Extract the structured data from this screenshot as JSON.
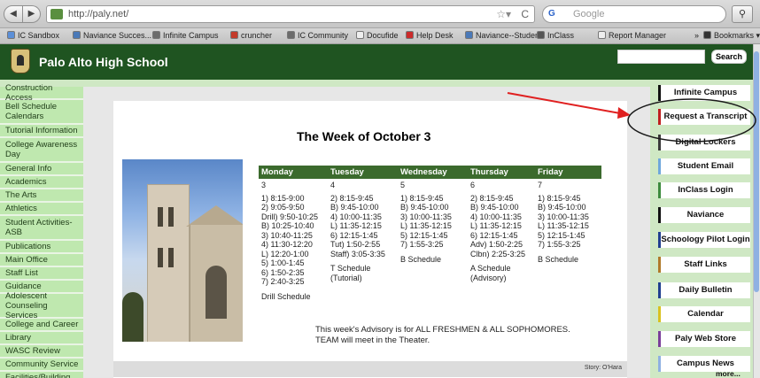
{
  "browser": {
    "url": "http://paly.net/",
    "search_engine_label": "G",
    "search_placeholder": "Google",
    "back_glyph": "◀",
    "forward_glyph": "▶",
    "star_glyph": "☆▾",
    "reload_glyph": "C",
    "magnifier_glyph": "⚲",
    "bookmarks": [
      {
        "label": "IC Sandbox",
        "color": "#5b8fd8"
      },
      {
        "label": "Naviance Succes...",
        "color": "#4a79b8"
      },
      {
        "label": "Infinite Campus",
        "color": "#6b6b6b"
      },
      {
        "label": "cruncher",
        "color": "#c33a2a"
      },
      {
        "label": "IC Community",
        "color": "#6b6b6b"
      },
      {
        "label": "Docufide",
        "color": "#eeeeee"
      },
      {
        "label": "Help Desk",
        "color": "#cc2a2a"
      },
      {
        "label": "Naviance--Student",
        "color": "#4a79b8"
      },
      {
        "label": "InClass",
        "color": "#555555"
      },
      {
        "label": "Report Manager",
        "color": "#eeeeee"
      },
      {
        "label": "»",
        "color": "transparent"
      },
      {
        "label": "Bookmarks ▾",
        "color": "#333333"
      }
    ]
  },
  "header": {
    "title": "Palo Alto High School",
    "search_button": "Search",
    "search_value": ""
  },
  "left_nav": [
    "Construction Access",
    "Bell Schedule Calendars",
    "Tutorial Information",
    "College Awareness Day",
    "General Info",
    "Academics",
    "The Arts",
    "Athletics",
    "Student Activities-ASB",
    "Publications",
    "Main Office",
    "Staff List",
    "Guidance",
    "Adolescent Counseling Services",
    "College and Career",
    "Library",
    "WASC Review",
    "Community Service",
    "Facilities/Building"
  ],
  "main": {
    "week_title": "The Week of October 3",
    "days": [
      {
        "name": "Monday",
        "num": "3",
        "times": [
          "1) 8:15-9:00",
          "2) 9:05-9:50",
          "Drill) 9:50-10:25",
          "B) 10:25-10:40",
          "3) 10:40-11:25",
          "4) 11:30-12:20",
          "L) 12:20-1:00",
          "5) 1:00-1:45",
          "6) 1:50-2:35",
          "7) 2:40-3:25"
        ],
        "footer": [
          "Drill Schedule"
        ]
      },
      {
        "name": "Tuesday",
        "num": "4",
        "times": [
          "2) 8:15-9:45",
          "B) 9:45-10:00",
          "4) 10:00-11:35",
          "L) 11:35-12:15",
          "6) 12:15-1:45",
          "Tut) 1:50-2:55",
          "Staff) 3:05-3:35"
        ],
        "footer": [
          "T Schedule",
          "(Tutorial)"
        ]
      },
      {
        "name": "Wednesday",
        "num": "5",
        "times": [
          "1) 8:15-9:45",
          "B) 9:45-10:00",
          "3) 10:00-11:35",
          "L) 11:35-12:15",
          "5) 12:15-1:45",
          "7) 1:55-3:25"
        ],
        "footer": [
          "B Schedule"
        ]
      },
      {
        "name": "Thursday",
        "num": "6",
        "times": [
          "2) 8:15-9:45",
          "B) 9:45-10:00",
          "4) 10:00-11:35",
          "L) 11:35-12:15",
          "6) 12:15-1:45",
          "Adv) 1:50-2:25",
          "Clbn) 2:25-3:25"
        ],
        "footer": [
          "A Schedule",
          "(Advisory)"
        ]
      },
      {
        "name": "Friday",
        "num": "7",
        "times": [
          "1) 8:15-9:45",
          "B) 9:45-10:00",
          "3) 10:00-11:35",
          "L) 11:35-12:15",
          "5) 12:15-1:45",
          "7) 1:55-3:25"
        ],
        "footer": [
          "B Schedule"
        ]
      }
    ],
    "advisory_note": "This week's Advisory is for ALL FRESHMEN & ALL SOPHOMORES. TEAM will meet in the Theater.",
    "credit": "Story: O'Hara"
  },
  "right_nav": [
    {
      "label": "Infinite Campus",
      "color": "#111111"
    },
    {
      "label": "Request a Transcript",
      "color": "#c0201f"
    },
    {
      "label": "Digital Lockers",
      "color": "#3a3a3a"
    },
    {
      "label": "Student Email",
      "color": "#6fa8dc"
    },
    {
      "label": "InClass Login",
      "color": "#3d8b3d"
    },
    {
      "label": "Naviance",
      "color": "#111111"
    },
    {
      "label": "Schoology Pilot Login",
      "color": "#1f3f8f"
    },
    {
      "label": "Staff Links",
      "color": "#b07a2a"
    },
    {
      "label": "Daily Bulletin",
      "color": "#1f3f8f"
    },
    {
      "label": "Calendar",
      "color": "#d9c21f"
    },
    {
      "label": "Paly Web Store",
      "color": "#7a3f9a"
    },
    {
      "label": "Campus News",
      "color": "#8fb1e2"
    }
  ],
  "right_more": "more...",
  "annotation": {
    "color": "#e02020"
  }
}
